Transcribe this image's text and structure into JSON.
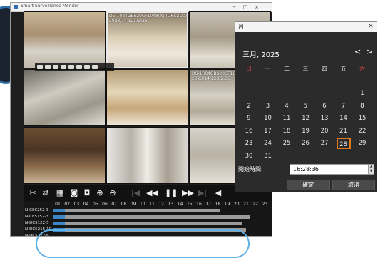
{
  "window": {
    "title": "Smart Surveillance Monitor",
    "minimize": "−",
    "maximize": "□",
    "close": "×"
  },
  "cameras": [
    {
      "label": "",
      "timestamp": ""
    },
    {
      "label": "DS-1084GBS20CF1048(X) (D6C2D0)",
      "timestamp": "2023/14 12:02:36"
    },
    {
      "label": "",
      "timestamp": ""
    },
    {
      "label": "",
      "timestamp": ""
    },
    {
      "label": "",
      "timestamp": ""
    },
    {
      "label": "DS-1084GBS20CF1048(X)",
      "timestamp": "2023/14 12:02:36"
    },
    {
      "label": "",
      "timestamp": ""
    },
    {
      "label": "",
      "timestamp": ""
    },
    {
      "label": "",
      "timestamp": ""
    }
  ],
  "playback": {
    "stop": "■",
    "rewind": "◀◀",
    "pause": "❚❚",
    "forward": "▶▶",
    "next_frame": "▶|",
    "prev_frame": "|◀",
    "slow": "◀"
  },
  "timeline": {
    "hours": [
      "01",
      "02",
      "03",
      "04",
      "05",
      "06",
      "07",
      "08",
      "09",
      "10",
      "11",
      "12",
      "13",
      "14",
      "15",
      "16",
      "17",
      "18",
      "19",
      "20",
      "21",
      "22",
      "23"
    ],
    "rows": [
      {
        "label": "N-C8C252-3",
        "fill": 0.78
      },
      {
        "label": "N-C85152-3",
        "fill": 0.92
      },
      {
        "label": "N-DC5122-5",
        "fill": 0.88
      },
      {
        "label": "N-DC5215-10",
        "fill": 0.9
      },
      {
        "label": "N-DC5122-6",
        "fill": 0.0
      }
    ]
  },
  "calendar": {
    "title": "月",
    "close": "×",
    "month_label": "三月, 2025",
    "prev": "<",
    "next": ">",
    "weekdays": [
      "日",
      "一",
      "二",
      "三",
      "四",
      "五",
      "六"
    ],
    "days": [
      [
        "",
        "",
        "",
        "",
        "",
        "",
        "1"
      ],
      [
        "2",
        "3",
        "4",
        "5",
        "6",
        "7",
        "8"
      ],
      [
        "9",
        "10",
        "11",
        "12",
        "13",
        "14",
        "15"
      ],
      [
        "16",
        "17",
        "18",
        "19",
        "20",
        "21",
        "22"
      ],
      [
        "23",
        "24",
        "25",
        "26",
        "27",
        "28",
        "29"
      ],
      [
        "30",
        "31",
        "",
        "",
        "",
        "",
        ""
      ]
    ],
    "today": "28",
    "time_label": "開始時間:",
    "time_value": "16:28:36",
    "ok": "確定",
    "cancel": "取消",
    "colors": {
      "weekend": "#e04040",
      "today_border": "#e07a20"
    }
  }
}
